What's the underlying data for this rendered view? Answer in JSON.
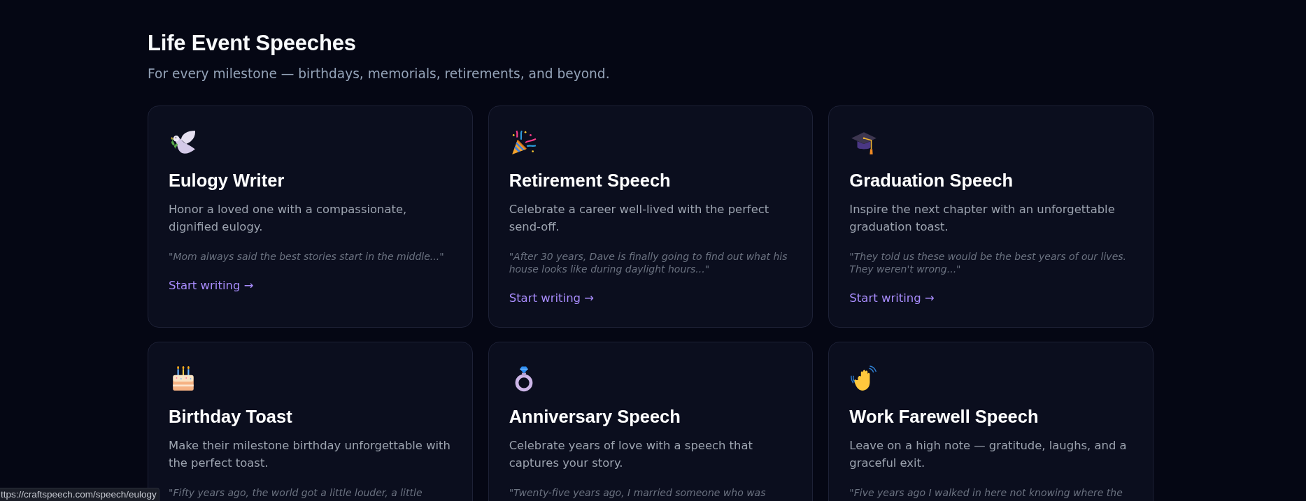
{
  "section": {
    "title": "Life Event Speeches",
    "subtitle": "For every milestone — birthdays, memorials, retirements, and beyond."
  },
  "cards": [
    {
      "title": "Eulogy Writer",
      "description": "Honor a loved one with a compassionate, dignified eulogy.",
      "quote": "\"Mom always said the best stories start in the middle...\"",
      "link": "Start writing →"
    },
    {
      "title": "Retirement Speech",
      "description": "Celebrate a career well-lived with the perfect send-off.",
      "quote": "\"After 30 years, Dave is finally going to find out what his house looks like during daylight hours...\"",
      "link": "Start writing →"
    },
    {
      "title": "Graduation Speech",
      "description": "Inspire the next chapter with an unforgettable graduation toast.",
      "quote": "\"They told us these would be the best years of our lives. They weren't wrong...\"",
      "link": "Start writing →"
    },
    {
      "title": "Birthday Toast",
      "description": "Make their milestone birthday unforgettable with the perfect toast.",
      "quote": "\"Fifty years ago, the world got a little louder, a little"
    },
    {
      "title": "Anniversary Speech",
      "description": "Celebrate years of love with a speech that captures your story.",
      "quote": "\"Twenty-five years ago, I married someone who was"
    },
    {
      "title": "Work Farewell Speech",
      "description": "Leave on a high note — gratitude, laughs, and a graceful exit.",
      "quote": "\"Five years ago I walked in here not knowing where the"
    }
  ],
  "status_bar": {
    "url": "ttps://craftspeech.com/speech/eulogy"
  }
}
